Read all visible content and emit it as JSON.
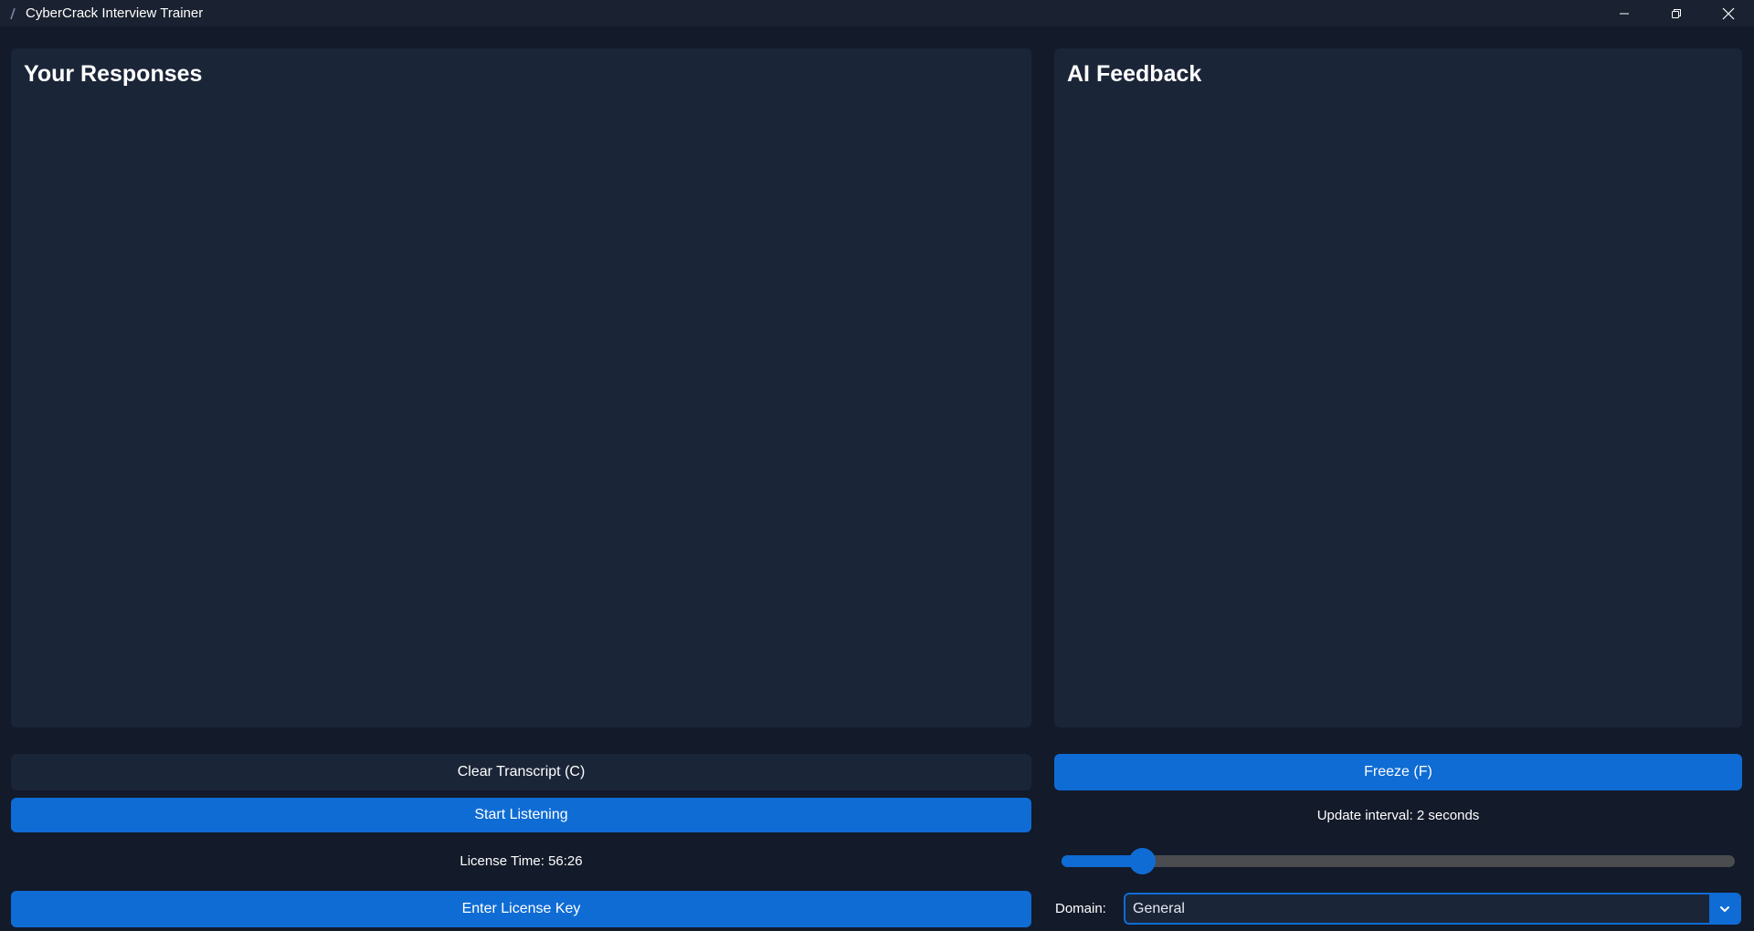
{
  "window": {
    "title": "CyberCrack Interview Trainer",
    "controls": [
      "minimize-icon",
      "restore-icon",
      "close-icon"
    ]
  },
  "panels": {
    "responses_title": "Your Responses",
    "feedback_title": "AI Feedback"
  },
  "controls": {
    "clear_label": "Clear Transcript (C)",
    "start_label": "Start Listening",
    "license_time": "License Time: 56:26",
    "license_key_label": "Enter License Key",
    "freeze_label": "Freeze (F)",
    "interval_label": "Update interval: 2 seconds",
    "interval_slider_fraction": 0.12,
    "domain_label": "Domain:",
    "domain_value": "General"
  },
  "colors": {
    "background": "#131a2a",
    "panel": "#1b2538",
    "accent": "#0f6cd4",
    "slider_track": "#4a4c50"
  }
}
